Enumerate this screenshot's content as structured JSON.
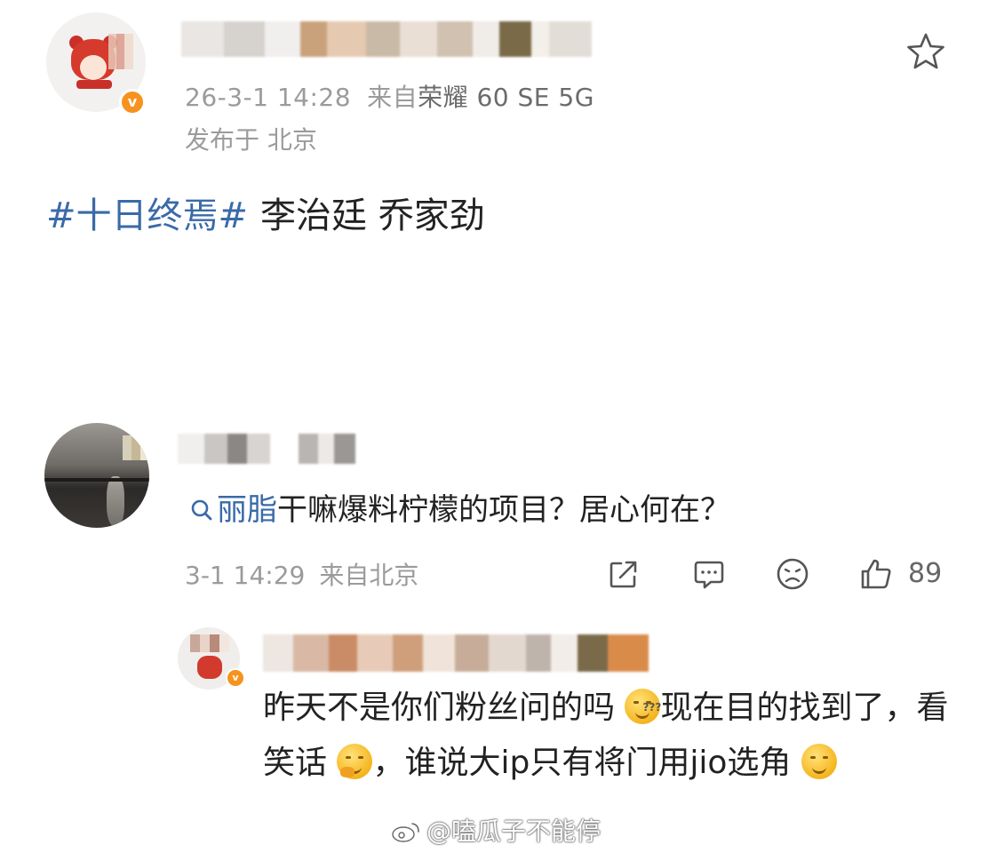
{
  "post": {
    "timestamp": "26-3-1 14:28",
    "source_prefix": "来自",
    "source_device": "荣耀 60 SE 5G",
    "location_label": "发布于 北京",
    "hashtag": "#十日终焉#",
    "body_text": "李治廷 乔家劲"
  },
  "comment": {
    "search_link": "丽脂",
    "text": "干嘛爆料柠檬的项目？居心何在？",
    "timestamp": "3-1 14:29",
    "source": "来自北京",
    "like_count": "89"
  },
  "reply": {
    "part1": "昨天不是你们粉丝问的吗",
    "part2": "现在目的找到了，看笑话",
    "part3": "，谁说大ip只有将门用jio选角"
  },
  "watermark": {
    "text": "@嗑瓜子不能停"
  },
  "colors": {
    "link": "#3a6aa8",
    "meta": "#9b9b9b",
    "verified_badge": "#f6921e"
  }
}
